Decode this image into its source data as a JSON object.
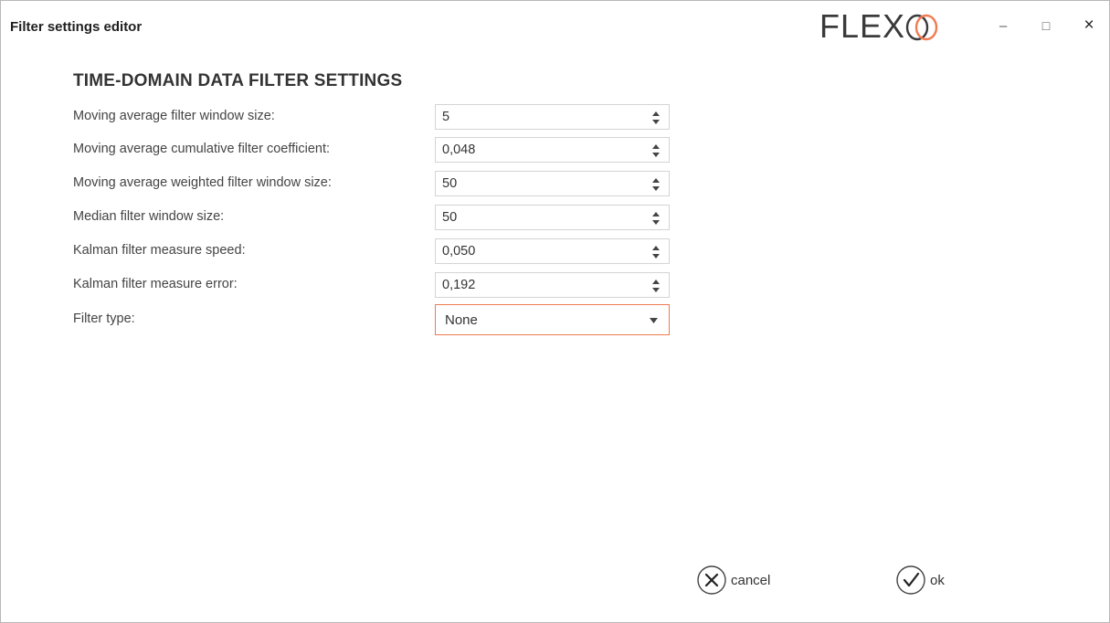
{
  "window": {
    "title": "Filter settings editor",
    "logo_text": "FLEX",
    "controls": {
      "minimize": "–",
      "maximize": "□",
      "close": "×"
    }
  },
  "section": {
    "title": "TIME-DOMAIN DATA FILTER SETTINGS"
  },
  "fields": [
    {
      "label": "Moving average filter window size:",
      "value": "5"
    },
    {
      "label": "Moving average cumulative filter coefficient:",
      "value": "0,048"
    },
    {
      "label": "Moving average weighted filter window size:",
      "value": "50"
    },
    {
      "label": "Median filter window size:",
      "value": "50"
    },
    {
      "label": "Kalman filter measure speed:",
      "value": "0,050"
    },
    {
      "label": "Kalman filter measure error:",
      "value": "0,192"
    }
  ],
  "filter_type": {
    "label": "Filter type:",
    "selected": "None"
  },
  "actions": {
    "cancel": "cancel",
    "ok": "ok"
  },
  "colors": {
    "accent": "#f07b50",
    "text": "#333333",
    "border": "#d4d4d4"
  },
  "icons": {
    "spinner": "up-down-arrows-icon",
    "dropdown": "chevron-down-icon",
    "cancel": "x-circle-icon",
    "ok": "check-circle-icon",
    "logo": "interlocking-rings-icon"
  }
}
